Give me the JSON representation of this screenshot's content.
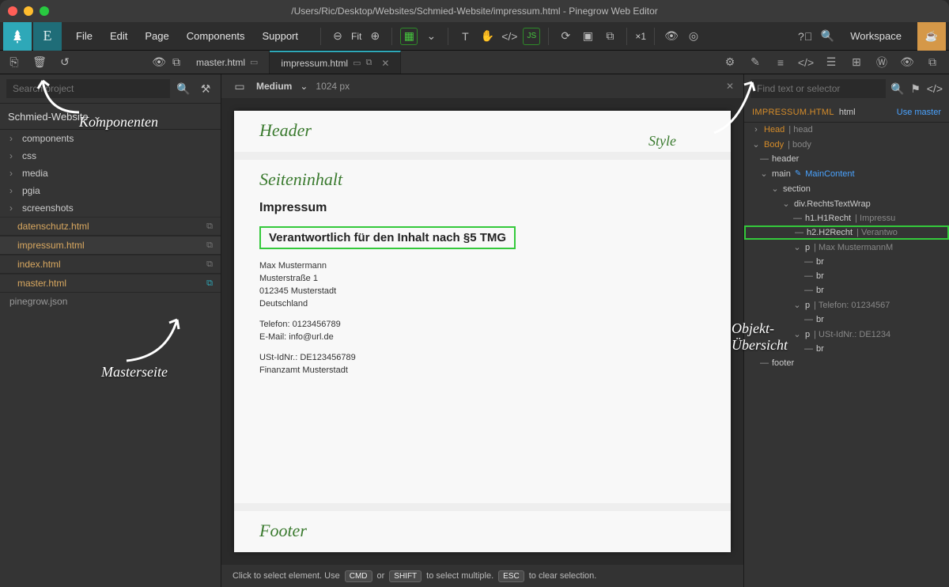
{
  "window": {
    "title": "/Users/Ric/Desktop/Websites/Schmied-Website/impressum.html - Pinegrow Web Editor"
  },
  "menubar": {
    "items": [
      "File",
      "Edit",
      "Page",
      "Components",
      "Support"
    ],
    "fit_label": "Fit",
    "zoom_label": "×1",
    "workspace_label": "Workspace"
  },
  "tabs": [
    {
      "label": "master.html",
      "active": false
    },
    {
      "label": "impressum.html",
      "active": true
    }
  ],
  "left_panel": {
    "search_placeholder": "Search project",
    "project_name": "Schmied-Website",
    "folders": [
      "components",
      "css",
      "media",
      "pgia",
      "screenshots"
    ],
    "files": [
      "datenschutz.html",
      "impressum.html",
      "index.html",
      "master.html"
    ],
    "json_file": "pinegrow.json"
  },
  "viewport": {
    "size_label": "Medium",
    "px_label": "1024 px"
  },
  "page": {
    "header_label": "Header",
    "section_label": "Seiteninhalt",
    "h1": "Impressum",
    "h2": "Verantwortlich für den Inhalt nach §5 TMG",
    "address": [
      "Max Mustermann",
      "Musterstraße 1",
      "012345 Musterstadt",
      "Deutschland"
    ],
    "contact": [
      "Telefon: 0123456789",
      "E-Mail: info@url.de"
    ],
    "tax": [
      "USt-IdNr.: DE123456789",
      "Finanzamt Musterstadt"
    ],
    "footer_label": "Footer"
  },
  "status": {
    "pre": "Click to select element. Use",
    "cmd": "CMD",
    "or": "or",
    "shift": "SHIFT",
    "mid": "to select multiple.",
    "esc": "ESC",
    "post": "to clear selection."
  },
  "right_panel": {
    "search_placeholder": "Find text or selector",
    "filename": "IMPRESSUM.HTML",
    "root_tag": "html",
    "use_master": "Use master",
    "tree": [
      {
        "indent": 0,
        "chev": "›",
        "tag": "Head",
        "txt": "head",
        "tagClass": "dom-tag-head"
      },
      {
        "indent": 0,
        "chev": "⌄",
        "tag": "Body",
        "txt": "body",
        "tagClass": "dom-tag-body"
      },
      {
        "indent": 1,
        "chev": "—",
        "tag": "header",
        "tagClass": "dom-tag-plain"
      },
      {
        "indent": 1,
        "chev": "⌄",
        "tag": "main",
        "cls": "MainContent",
        "tagClass": "dom-tag-plain"
      },
      {
        "indent": 2,
        "chev": "⌄",
        "tag": "section",
        "tagClass": "dom-tag-plain"
      },
      {
        "indent": 3,
        "chev": "⌄",
        "tag": "div.RechtsTextWrap",
        "tagClass": "dom-tag-plain"
      },
      {
        "indent": 4,
        "chev": "—",
        "tag": "h1.H1Recht",
        "txt": "Impressu",
        "tagClass": "dom-tag-plain"
      },
      {
        "indent": 4,
        "chev": "—",
        "tag": "h2.H2Recht",
        "txt": "Verantwo",
        "tagClass": "dom-tag-plain",
        "sel": true
      },
      {
        "indent": 4,
        "chev": "⌄",
        "tag": "p",
        "txt": "Max MustermannM",
        "tagClass": "dom-tag-plain"
      },
      {
        "indent": 5,
        "chev": "—",
        "tag": "br",
        "tagClass": "dom-tag-plain"
      },
      {
        "indent": 5,
        "chev": "—",
        "tag": "br",
        "tagClass": "dom-tag-plain"
      },
      {
        "indent": 5,
        "chev": "—",
        "tag": "br",
        "tagClass": "dom-tag-plain"
      },
      {
        "indent": 4,
        "chev": "⌄",
        "tag": "p",
        "txt": "Telefon: 01234567",
        "tagClass": "dom-tag-plain"
      },
      {
        "indent": 5,
        "chev": "—",
        "tag": "br",
        "tagClass": "dom-tag-plain"
      },
      {
        "indent": 4,
        "chev": "⌄",
        "tag": "p",
        "txt": "USt-IdNr.: DE1234",
        "tagClass": "dom-tag-plain"
      },
      {
        "indent": 5,
        "chev": "—",
        "tag": "br",
        "tagClass": "dom-tag-plain"
      },
      {
        "indent": 1,
        "chev": "—",
        "tag": "footer",
        "tagClass": "dom-tag-plain"
      }
    ]
  },
  "annotations": {
    "komponenten": "Komponenten",
    "masterseite": "Masterseite",
    "style": "Style",
    "objekt": "Objekt-\nÜbersicht"
  }
}
